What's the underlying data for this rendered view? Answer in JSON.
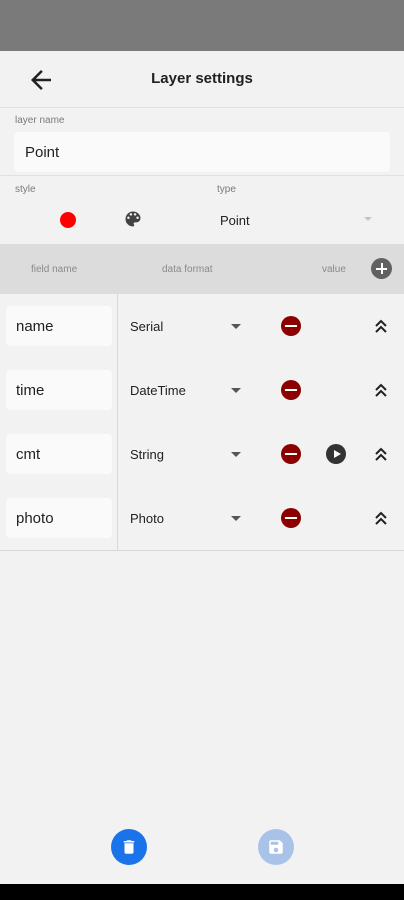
{
  "app_bar": {
    "title": "Layer settings",
    "back_icon": "arrow-back-icon"
  },
  "layer": {
    "name_label": "layer name",
    "name_value": "Point",
    "style_label": "style",
    "style_color": "#ff0000",
    "palette_icon": "palette-icon",
    "type_label": "type",
    "type_value": "Point"
  },
  "table": {
    "headers": {
      "field_name": "field name",
      "data_format": "data format",
      "value": "value"
    },
    "add_icon": "add-circle-icon"
  },
  "fields": [
    {
      "name": "name",
      "format": "Serial"
    },
    {
      "name": "time",
      "format": "DateTime"
    },
    {
      "name": "cmt",
      "format": "String",
      "has_play_button": true
    },
    {
      "name": "photo",
      "format": "Photo"
    }
  ],
  "actions": {
    "delete_icon": "trash-icon",
    "save_icon": "save-icon",
    "primary_color": "#1a73e8",
    "disabled_color": "#a9c3e8",
    "remove_color": "#8b0000"
  }
}
